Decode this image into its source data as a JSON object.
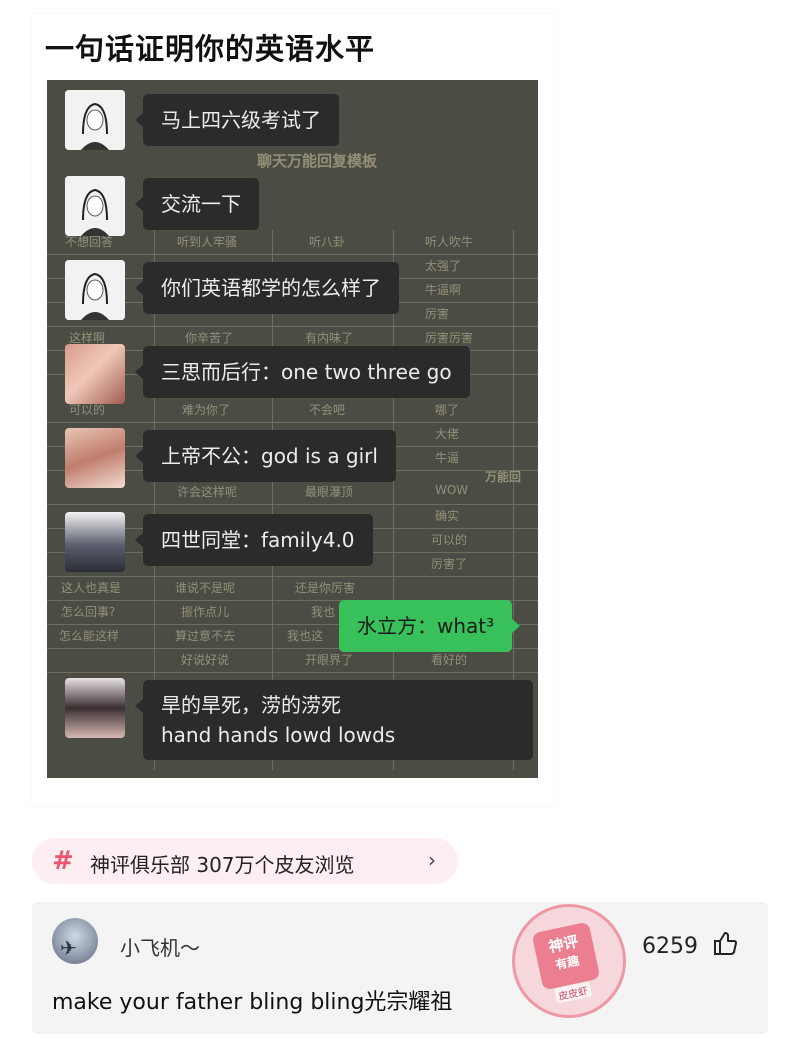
{
  "post": {
    "title": "一句话证明你的英语水平"
  },
  "background_sheet": {
    "title": "聊天万能回复模板",
    "header_cells": [
      "不想回答",
      "听到人牢骚",
      "听八卦",
      "听人吹牛"
    ],
    "rows": [
      [
        "",
        "",
        "",
        "太强了"
      ],
      [
        "",
        "",
        "",
        "牛逼啊"
      ],
      [
        "",
        "",
        "",
        "厉害"
      ],
      [
        "这样啊",
        "你辛苦了",
        "有内味了",
        "厉害厉害"
      ],
      [
        "",
        "",
        "",
        ""
      ],
      [
        "可以的",
        "难为你了",
        "不会吧",
        "哪了"
      ],
      [
        "",
        "",
        "",
        "大佬"
      ],
      [
        "",
        "",
        "",
        "牛逼"
      ],
      [
        "",
        "许会这样呢",
        "最眼瀑顶",
        "WOW"
      ],
      [
        "",
        "",
        "",
        "确实"
      ],
      [
        "",
        "",
        "",
        "可以的"
      ],
      [
        "",
        "",
        "",
        "厉害了"
      ],
      [
        "这人也真是",
        "谁说不是呢",
        "还是你厉害",
        ""
      ],
      [
        "怎么回事?",
        "振作点儿",
        "我也",
        ""
      ],
      [
        "怎么能这样",
        "算过意不去",
        "我也这",
        ""
      ],
      [
        "",
        "好说好说",
        "开眼界了",
        "看好的"
      ]
    ],
    "side_label": "万能回"
  },
  "messages": [
    {
      "avatar": "sketch",
      "text": "马上四六级考试了"
    },
    {
      "avatar": "sketch",
      "text": "交流一下"
    },
    {
      "avatar": "sketch",
      "text": "你们英语都学的怎么样了"
    },
    {
      "avatar": "warm1",
      "text": "三思而后行：one two three go"
    },
    {
      "avatar": "warm2",
      "text": "上帝不公：god is a girl"
    },
    {
      "avatar": "dark",
      "text": "四世同堂：family4.0"
    },
    {
      "avatar": "self",
      "text": "水立方：what³"
    },
    {
      "avatar": "girl",
      "line1": "旱的旱死，涝的涝死",
      "line2": "hand hands lowd lowds"
    }
  ],
  "topic": {
    "hash": "#",
    "text": "神评俱乐部  307万个皮友浏览",
    "arrow": "›"
  },
  "comment": {
    "user": "小飞机～",
    "text": "make your father bling bling光宗耀祖",
    "likes": "6259",
    "stamp_line1": "神评",
    "stamp_line2": "有趣",
    "stamp_sub": "皮皮虾"
  },
  "colors": {
    "accent_pink": "#e8576f",
    "chat_bubble": "#2b2b2b",
    "self_bubble": "#38c05a",
    "image_bg": "#4b4c44"
  }
}
